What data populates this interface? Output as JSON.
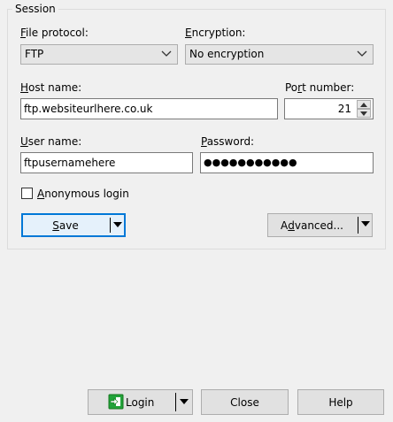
{
  "session": {
    "group_title": "Session",
    "file_protocol": {
      "label_mn": "F",
      "label_rest": "ile protocol:",
      "value": "FTP"
    },
    "encryption": {
      "label_mn": "E",
      "label_rest": "ncryption:",
      "value": "No encryption"
    },
    "host_name": {
      "label_mn": "H",
      "label_rest": "ost name:",
      "value": "ftp.websiteurlhere.co.uk"
    },
    "port_number": {
      "label_pre": "Po",
      "label_mn": "r",
      "label_rest": "t number:",
      "value": "21"
    },
    "user_name": {
      "label_mn": "U",
      "label_rest": "ser name:",
      "value": "ftpusernamehere"
    },
    "password": {
      "label_mn": "P",
      "label_rest": "assword:",
      "value": "●●●●●●●●●●●"
    },
    "anonymous": {
      "label_mn": "A",
      "label_rest": "nonymous login",
      "checked": false
    },
    "save_button": {
      "label_mn": "S",
      "label_rest": "ave"
    },
    "advanced_button": {
      "label_pre": "A",
      "label_mn": "d",
      "label_rest": "vanced..."
    }
  },
  "footer": {
    "login_label": "Login",
    "close_label": "Close",
    "help_label": "Help"
  },
  "colors": {
    "background": "#f0f0f0",
    "focus_border": "#0078d7",
    "login_icon": "#22a33a"
  },
  "icons": [
    "chevron-down-icon",
    "spin-up-icon",
    "spin-down-icon",
    "dropdown-arrow-icon",
    "login-icon"
  ]
}
